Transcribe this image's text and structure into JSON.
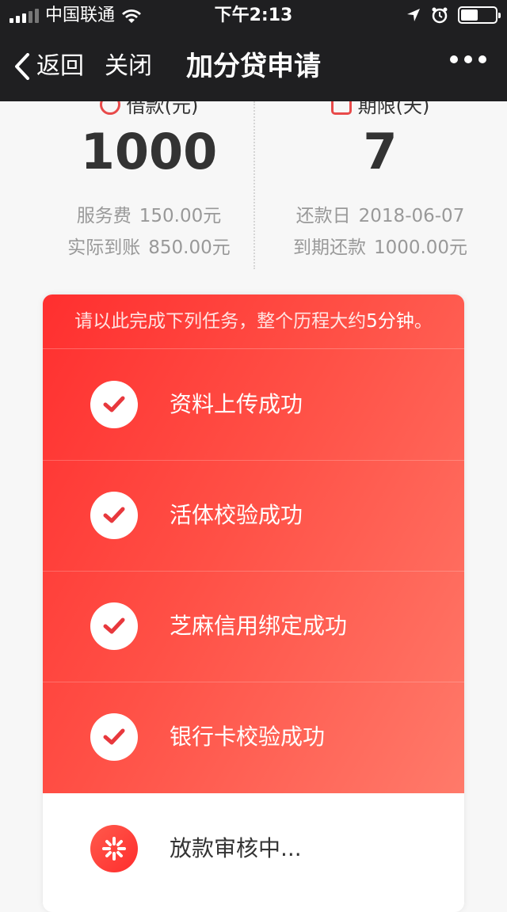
{
  "status_bar": {
    "carrier": "中国联通",
    "time": "下午2:13"
  },
  "nav": {
    "back_label": "返回",
    "close_label": "关闭",
    "title": "加分贷申请"
  },
  "summary": {
    "left": {
      "heading": "借款(元)",
      "value": "1000",
      "rows": [
        {
          "label": "服务费",
          "value": "150.00元"
        },
        {
          "label": "实际到账",
          "value": "850.00元"
        }
      ]
    },
    "right": {
      "heading": "期限(天)",
      "value": "7",
      "rows": [
        {
          "label": "还款日",
          "value": "2018-06-07"
        },
        {
          "label": "到期还款",
          "value": "1000.00元"
        }
      ]
    }
  },
  "tasks": {
    "notice_prefix": "请以此完成下列任务，整个历程大约",
    "notice_highlight": "5分钟",
    "notice_suffix": "。",
    "items": [
      {
        "label": "资料上传成功",
        "status": "done"
      },
      {
        "label": "活体校验成功",
        "status": "done"
      },
      {
        "label": "芝麻信用绑定成功",
        "status": "done"
      },
      {
        "label": "银行卡校验成功",
        "status": "done"
      },
      {
        "label": "放款审核中...",
        "status": "pending"
      }
    ]
  },
  "colors": {
    "accent_red": "#ff3b30",
    "bar_dark": "#1f1f21"
  }
}
